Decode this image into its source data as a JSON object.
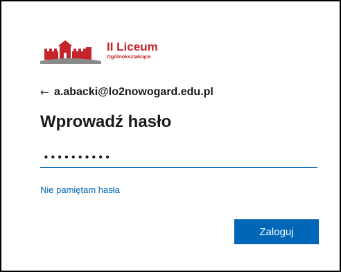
{
  "logo": {
    "name": "II Liceum",
    "subtitle": "Ogólnokształcące",
    "icon": "castle-icon",
    "color": "#c5242a"
  },
  "identity": {
    "back_icon": "back-arrow-icon",
    "back_glyph": "←",
    "email": "a.abacki@lo2nowogard.edu.pl"
  },
  "title": "Wprowadź hasło",
  "password": {
    "value": "••••••••••",
    "masked_length": 10
  },
  "forgot_password_link": "Nie pamiętam hasła",
  "signin_button": "Zaloguj",
  "colors": {
    "accent": "#0067b8",
    "brand": "#c5242a",
    "text": "#1b1b1b"
  }
}
